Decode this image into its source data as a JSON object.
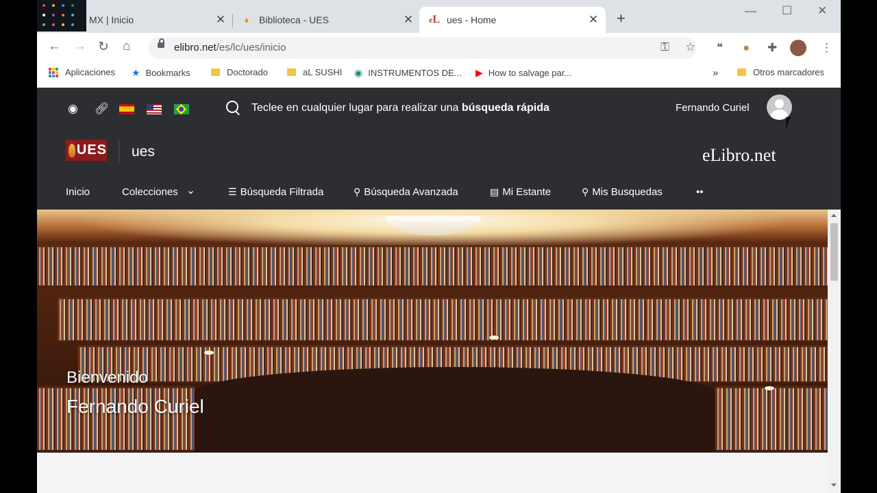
{
  "browser": {
    "tabs": [
      {
        "title": "MX | Inicio",
        "favicon": "multicolor-thumbnail-icon"
      },
      {
        "title": "Biblioteca - UES",
        "favicon": "flame-icon"
      },
      {
        "title": "ues - Home",
        "favicon": "eL",
        "active": true
      }
    ],
    "new_tab_label": "+",
    "controls": {
      "minimize": "—",
      "maximize": "☐",
      "close": "✕"
    },
    "url": {
      "host": "elibro.net",
      "path": "/es/lc/ues/inicio"
    },
    "bookmarks": [
      {
        "label": "Aplicaciones",
        "icon": "apps-grid-icon"
      },
      {
        "label": "Bookmarks",
        "icon": "star-icon"
      },
      {
        "label": "Doctorado",
        "icon": "folder-icon"
      },
      {
        "label": "aL SUSHI",
        "icon": "folder-icon"
      },
      {
        "label": "INSTRUMENTOS DE...",
        "icon": "globe-icon"
      },
      {
        "label": "How to salvage par...",
        "icon": "youtube-icon"
      }
    ],
    "bookmarks_overflow": "»",
    "other_bookmarks": "Otros marcadores"
  },
  "site": {
    "quick_search_prefix": "Teclee en cualquier lugar para realizar una ",
    "quick_search_bold": "búsqueda rápida",
    "user_name": "Fernando Curiel",
    "logo_text": "UES",
    "institution": "ues",
    "brand": "eLibro.net",
    "nav": [
      {
        "label": "Inicio"
      },
      {
        "label": "Colecciones",
        "caret": "⌄"
      },
      {
        "label": "Búsqueda Filtrada",
        "icon": "☰"
      },
      {
        "label": "Búsqueda Avanzada",
        "icon": "⚲"
      },
      {
        "label": "Mi Estante",
        "icon": "▤"
      },
      {
        "label": "Mis Busquedas",
        "icon": "⚲"
      }
    ],
    "nav_more": "••",
    "hero_welcome": "Bienvenido",
    "hero_name": "Fernando Curiel"
  },
  "colors": {
    "header_bg": "#2d2e32",
    "logo_red": "#8c1c1c",
    "tabstrip_bg": "#dee1e6"
  }
}
